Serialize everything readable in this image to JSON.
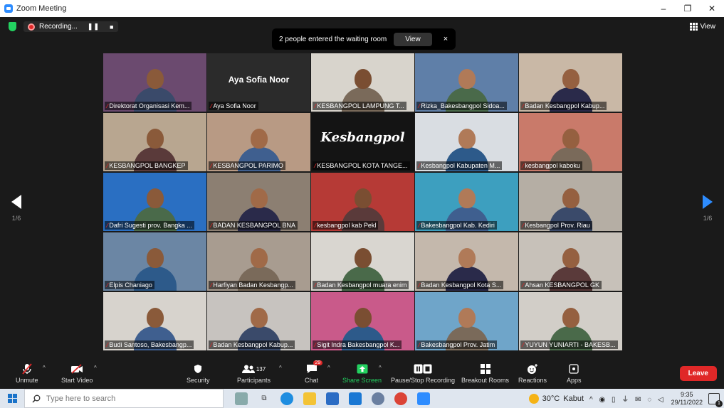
{
  "window": {
    "title": "Zoom Meeting",
    "minimize": "–",
    "maximize": "❐",
    "close": "✕"
  },
  "topbar": {
    "recording_label": "Recording...",
    "pause_glyph": "❚❚",
    "stop_glyph": "■",
    "view_label": "View"
  },
  "notification": {
    "text": "2 people entered the waiting room",
    "view_button": "View",
    "close_glyph": "×"
  },
  "pagination": {
    "left_label": "1/6",
    "right_label": "1/6"
  },
  "participants": [
    {
      "name": "Direktorat Organisasi Kem...",
      "active": true,
      "bg": "#6b4a6f"
    },
    {
      "name": "Aya Sofia Noor",
      "big_name": "Aya Sofia Noor",
      "bg": "#2b2b2b"
    },
    {
      "name": "KESBANGPOL LAMPUNG T...",
      "bg": "#d8d4cc"
    },
    {
      "name": "Rizka_Bakesbangpol Sidoa...",
      "bg": "#5f7fa8"
    },
    {
      "name": "Badan Kesbangpol Kabup...",
      "bg": "#c9b8a6"
    },
    {
      "name": "KESBANGPOL BANGKEP",
      "bg": "#b8a690"
    },
    {
      "name": "KESBANGPOL PARIMO",
      "bg": "#b89a84"
    },
    {
      "name": "KESBANGPOL KOTA TANGE...",
      "bg": "#141414",
      "logo": "Kesbangpol"
    },
    {
      "name": "Kesbangpol Kabupaten M...",
      "bg": "#d9dde2"
    },
    {
      "name": "kesbangpol kaboku",
      "bg": "#c97a6a"
    },
    {
      "name": "Dafri Sugesti prov. Bangka ...",
      "bg": "#2a6fc2"
    },
    {
      "name": "BADAN KESBANGPOL BNA",
      "bg": "#8c7f72"
    },
    {
      "name": "kesbangpol kab Pekl",
      "bg": "#b63a36"
    },
    {
      "name": "Bakesbangpol Kab. Kediri",
      "bg": "#3d9fbf"
    },
    {
      "name": "Kesbangpol Prov. Riau",
      "bg": "#b5aea4"
    },
    {
      "name": "Elpis Chaniago",
      "bg": "#6b86a4"
    },
    {
      "name": "Harfiyan Badan Kesbangp...",
      "bg": "#a89c90"
    },
    {
      "name": "Badan Kesbangpol muara enim",
      "bg": "#d9d6d0"
    },
    {
      "name": "Badan Kesbangpol Kota S...",
      "bg": "#c4b8ac"
    },
    {
      "name": "Ahsan KESBANGPOL GK",
      "bg": "#c7c1b9"
    },
    {
      "name": "Budi Santoso, Bakesbangp...",
      "bg": "#d7d3cd"
    },
    {
      "name": "Badan Kesbangpol Kabup...",
      "bg": "#c7c3bf"
    },
    {
      "name": "Sigit Indra Bakesbangpol K...",
      "bg": "#c95a8a"
    },
    {
      "name": "Bakesbangpol Prov. Jatim",
      "bg": "#6fa5c9"
    },
    {
      "name": "YUYUN YUNIARTI - BAKESB...",
      "bg": "#d2cec8"
    }
  ],
  "toolbar": {
    "unmute": "Unmute",
    "start_video": "Start Video",
    "security": "Security",
    "participants": "Participants",
    "participants_count": "137",
    "chat": "Chat",
    "chat_badge": "29",
    "share_screen": "Share Screen",
    "pause_stop_recording": "Pause/Stop Recording",
    "breakout_rooms": "Breakout Rooms",
    "reactions": "Reactions",
    "apps": "Apps",
    "leave": "Leave"
  },
  "taskbar": {
    "search_placeholder": "Type here to search",
    "weather_temp": "30°C",
    "weather_desc": "Kabut",
    "time": "9:35",
    "date": "29/11/2022",
    "notif_count": "1"
  },
  "colors": {
    "zoom_blue": "#2d8cff",
    "leave_red": "#e02828",
    "share_green": "#23d160",
    "active_speaker": "#e8e35b"
  }
}
